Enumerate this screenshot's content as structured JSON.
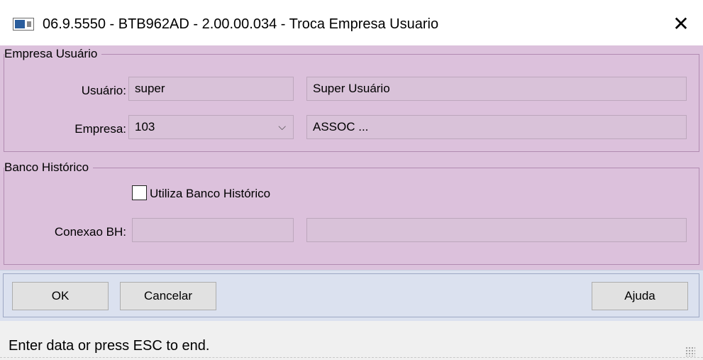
{
  "window": {
    "title": "06.9.5550 - BTB962AD - 2.00.00.034 - Troca Empresa Usuario",
    "close_glyph": "✕"
  },
  "empresa_usuario": {
    "legend": "Empresa Usuário",
    "usuario_label": "Usuário:",
    "usuario_code": "super",
    "usuario_name": "Super Usuário",
    "empresa_label": "Empresa:",
    "empresa_code": "103",
    "empresa_name": "ASSOC ..."
  },
  "banco_historico": {
    "legend": "Banco Histórico",
    "checkbox_label": "Utiliza Banco Histórico",
    "checkbox_checked": false,
    "conexao_label": "Conexao BH:",
    "conexao_code": "",
    "conexao_desc": ""
  },
  "buttons": {
    "ok": "OK",
    "cancel": "Cancelar",
    "help": "Ajuda"
  },
  "status": {
    "text": "Enter data or press ESC to end."
  },
  "colors": {
    "panel_bg": "#dcc1dc",
    "button_bar_bg": "#dbe1ef"
  }
}
